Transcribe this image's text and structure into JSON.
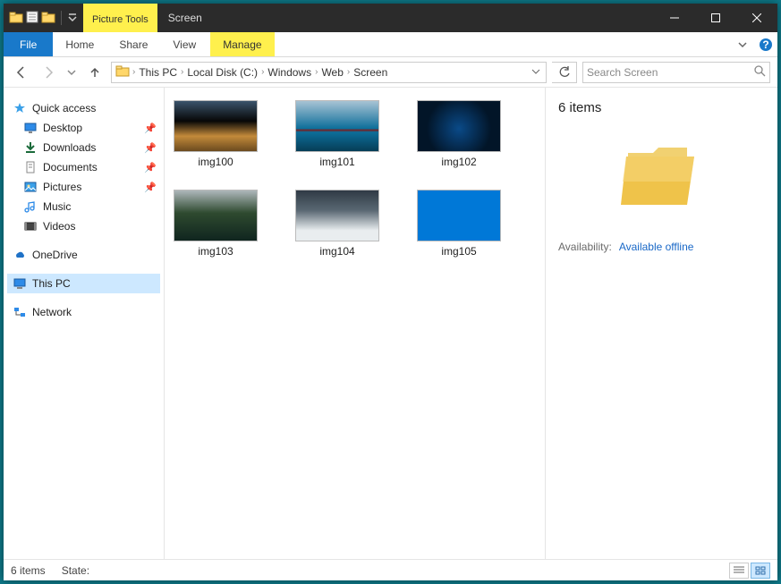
{
  "window": {
    "tool_tab_label": "Picture Tools",
    "title": "Screen"
  },
  "ribbon": {
    "file": "File",
    "tabs": [
      "Home",
      "Share",
      "View"
    ],
    "tool_tab": "Manage"
  },
  "address": {
    "crumbs": [
      "This PC",
      "Local Disk (C:)",
      "Windows",
      "Web",
      "Screen"
    ],
    "search_placeholder": "Search Screen"
  },
  "nav": {
    "quick_access": "Quick access",
    "pinned": [
      {
        "label": "Desktop",
        "icon": "desktop"
      },
      {
        "label": "Downloads",
        "icon": "downloads"
      },
      {
        "label": "Documents",
        "icon": "documents"
      },
      {
        "label": "Pictures",
        "icon": "pictures"
      }
    ],
    "recent": [
      {
        "label": "Music",
        "icon": "music"
      },
      {
        "label": "Videos",
        "icon": "videos"
      }
    ],
    "onedrive": "OneDrive",
    "thispc": "This PC",
    "network": "Network"
  },
  "files": [
    {
      "name": "img100",
      "bg": "linear-gradient(180deg,#3a536b 0%,#070707 40%,#c38a3a 70%,#6b4a1f 100%)"
    },
    {
      "name": "img101",
      "bg": "linear-gradient(180deg,#a8c3d4 0%,#0d6e9a 55%,#7a1f1f 58%,#0d6e9a 62%,#063d56 100%)"
    },
    {
      "name": "img102",
      "bg": "radial-gradient(circle at 50% 55%,#0a4a88 0%,#021528 65%)"
    },
    {
      "name": "img103",
      "bg": "linear-gradient(180deg,#aeb7bb 0%,#2e4a2f 45%,#10251f 100%)"
    },
    {
      "name": "img104",
      "bg": "linear-gradient(180deg,#2f3a45 0%,#5a6873 40%,#e9edef 80%)"
    },
    {
      "name": "img105",
      "bg": "#0078d7"
    }
  ],
  "details": {
    "header": "6 items",
    "availability_label": "Availability:",
    "availability_value": "Available offline"
  },
  "status": {
    "count": "6 items",
    "state_label": "State:"
  }
}
